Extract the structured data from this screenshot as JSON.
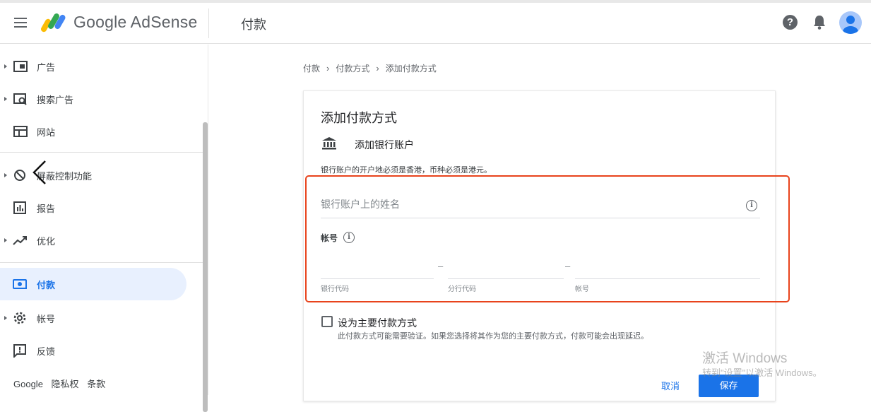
{
  "header": {
    "brand": "Google AdSense",
    "page_title": "付款"
  },
  "sidebar": {
    "items": [
      {
        "label": "广告",
        "icon": "ads-icon",
        "caret": true
      },
      {
        "label": "搜索广告",
        "icon": "search-ads-icon",
        "caret": true
      },
      {
        "label": "网站",
        "icon": "sites-icon",
        "caret": false
      },
      {
        "label": "屏蔽控制功能",
        "icon": "block-icon",
        "caret": true
      },
      {
        "label": "报告",
        "icon": "reports-icon",
        "caret": false
      },
      {
        "label": "优化",
        "icon": "optimize-icon",
        "caret": true
      },
      {
        "label": "付款",
        "icon": "payments-icon",
        "caret": false,
        "active": true
      },
      {
        "label": "帐号",
        "icon": "gear-icon",
        "caret": true
      },
      {
        "label": "反馈",
        "icon": "feedback-icon",
        "caret": false
      }
    ],
    "footer": {
      "google": "Google",
      "privacy": "隐私权",
      "terms": "条款"
    }
  },
  "breadcrumb": {
    "items": [
      "付款",
      "付款方式",
      "添加付款方式"
    ]
  },
  "card": {
    "title": "添加付款方式",
    "bank_label": "添加银行账户",
    "bank_note": "银行账户的开户地必须是香港，币种必须是港元。",
    "name_placeholder": "银行账户上的姓名",
    "account_label": "帐号",
    "sub_fields": [
      "银行代码",
      "分行代码",
      "帐号"
    ],
    "dash": "–",
    "primary_label": "设为主要付款方式",
    "primary_note": "此付款方式可能需要验证。如果您选择将其作为您的主要付款方式，付款可能会出现延迟。",
    "cancel": "取消",
    "save": "保存"
  },
  "watermark": {
    "line1": "激活 Windows",
    "line2": "转到\"设置\"以激活 Windows。"
  },
  "colors": {
    "accent": "#1a73e8",
    "highlight_border": "#e8431c",
    "active_bg": "#e8f0fe"
  }
}
